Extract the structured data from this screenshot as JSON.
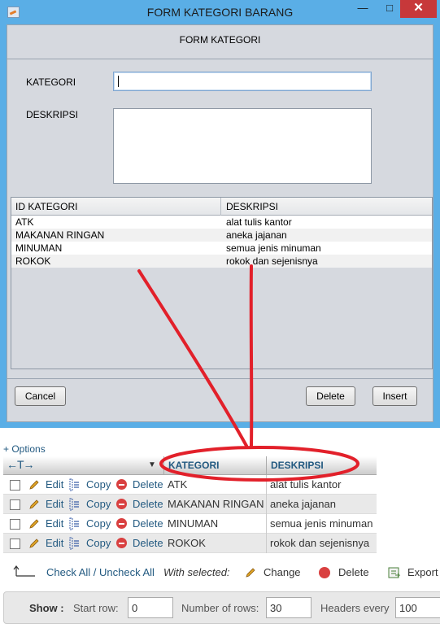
{
  "window": {
    "title": "FORM KATEGORI BARANG",
    "min_glyph": "—",
    "max_glyph": "□",
    "close_glyph": "✕"
  },
  "form": {
    "header": "FORM KATEGORI",
    "kategori_label": "KATEGORI",
    "kategori_value": "",
    "deskripsi_label": "DESKRIPSI",
    "deskripsi_value": ""
  },
  "table": {
    "columns": [
      "ID KATEGORI",
      "DESKRIPSI"
    ],
    "rows": [
      {
        "id": "ATK",
        "desc": "alat tulis kantor"
      },
      {
        "id": "MAKANAN RINGAN",
        "desc": "aneka jajanan"
      },
      {
        "id": "MINUMAN",
        "desc": "semua jenis minuman"
      },
      {
        "id": "ROKOK",
        "desc": "rokok dan sejenisnya"
      }
    ]
  },
  "buttons": {
    "cancel": "Cancel",
    "delete": "Delete",
    "insert": "Insert"
  },
  "pma": {
    "options": "+ Options",
    "arrows": "←T→",
    "columns": [
      "KATEGORI",
      "DESKRIPSI"
    ],
    "actions": {
      "edit": "Edit",
      "copy": "Copy",
      "delete": "Delete"
    },
    "rows": [
      {
        "kategori": "ATK",
        "deskripsi": "alat tulis kantor"
      },
      {
        "kategori": "MAKANAN RINGAN",
        "deskripsi": "aneka jajanan"
      },
      {
        "kategori": "MINUMAN",
        "deskripsi": "semua jenis minuman"
      },
      {
        "kategori": "ROKOK",
        "deskripsi": "rokok dan sejenisnya"
      }
    ],
    "check_all": "Check All / Uncheck All",
    "with_selected": "With selected:",
    "change": "Change",
    "delete": "Delete",
    "export": "Export",
    "show": "Show :",
    "start_row_label": "Start row:",
    "start_row_value": "0",
    "num_rows_label": "Number of rows:",
    "num_rows_value": "30",
    "headers_every_label": "Headers every",
    "headers_every_value": "100"
  },
  "colors": {
    "window_frame": "#5aaee6",
    "client_bg": "#d6d9df",
    "close_button": "#c7383a",
    "link_blue": "#235a81",
    "annotation_red": "#e2202a"
  }
}
